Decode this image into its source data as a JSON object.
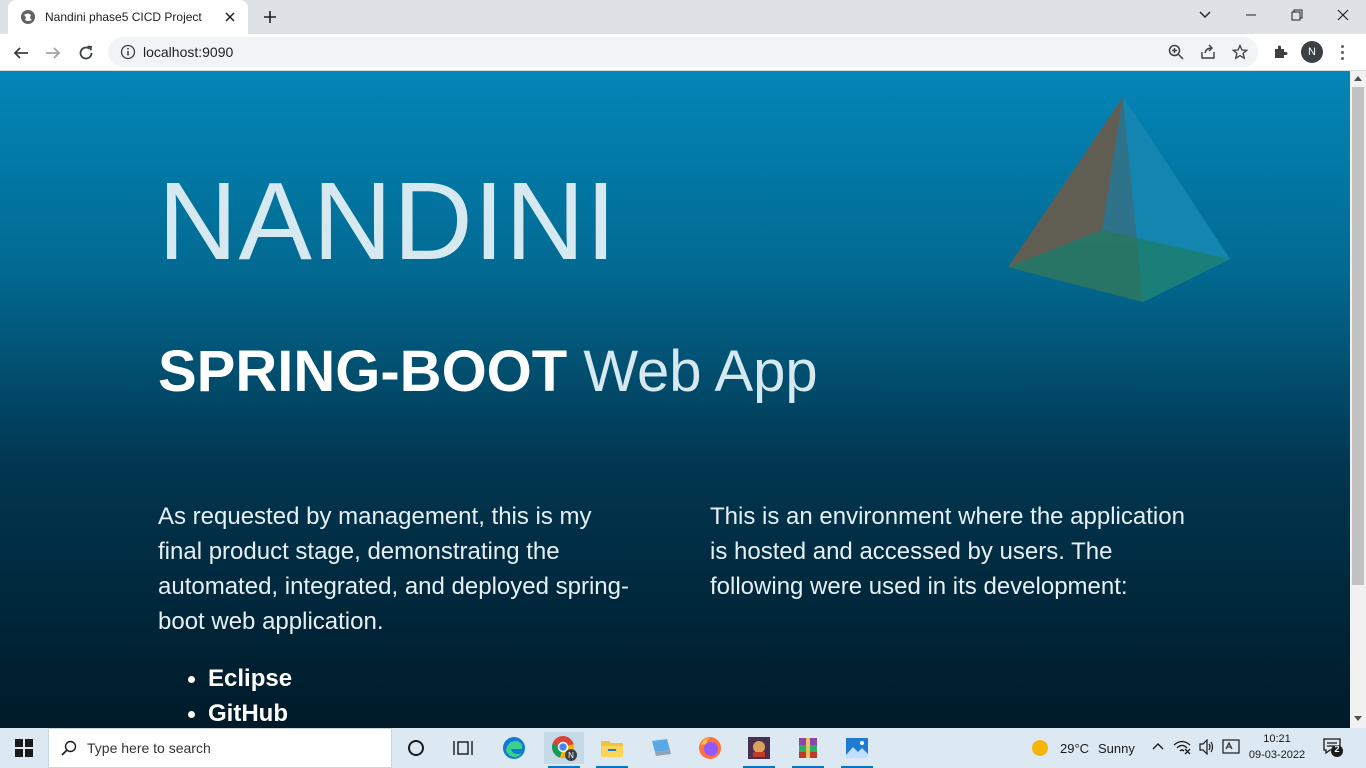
{
  "browser": {
    "tab_title": "Nandini phase5 CICD Project",
    "url": "localhost:9090",
    "profile_initial": "N"
  },
  "page": {
    "title": "NANDINI",
    "subtitle_bold": "SPRING-BOOT",
    "subtitle_light": "Web App",
    "paragraph_left": "As requested by management, this is my final product stage, demonstrating the automated, integrated, and deployed spring-boot web application.",
    "paragraph_right": "This is an environment where the application is hosted and accessed by users. The following were used in its development:",
    "tools": [
      "Eclipse",
      "GitHub"
    ]
  },
  "taskbar": {
    "search_placeholder": "Type here to search",
    "weather_temp": "29°C",
    "weather_text": "Sunny",
    "time": "10:21",
    "date": "09-03-2022",
    "notification_count": "2"
  },
  "colors": {
    "gradient_top": "#0386b8",
    "gradient_bottom": "#001a28",
    "title_color": "#d6e8f0"
  }
}
